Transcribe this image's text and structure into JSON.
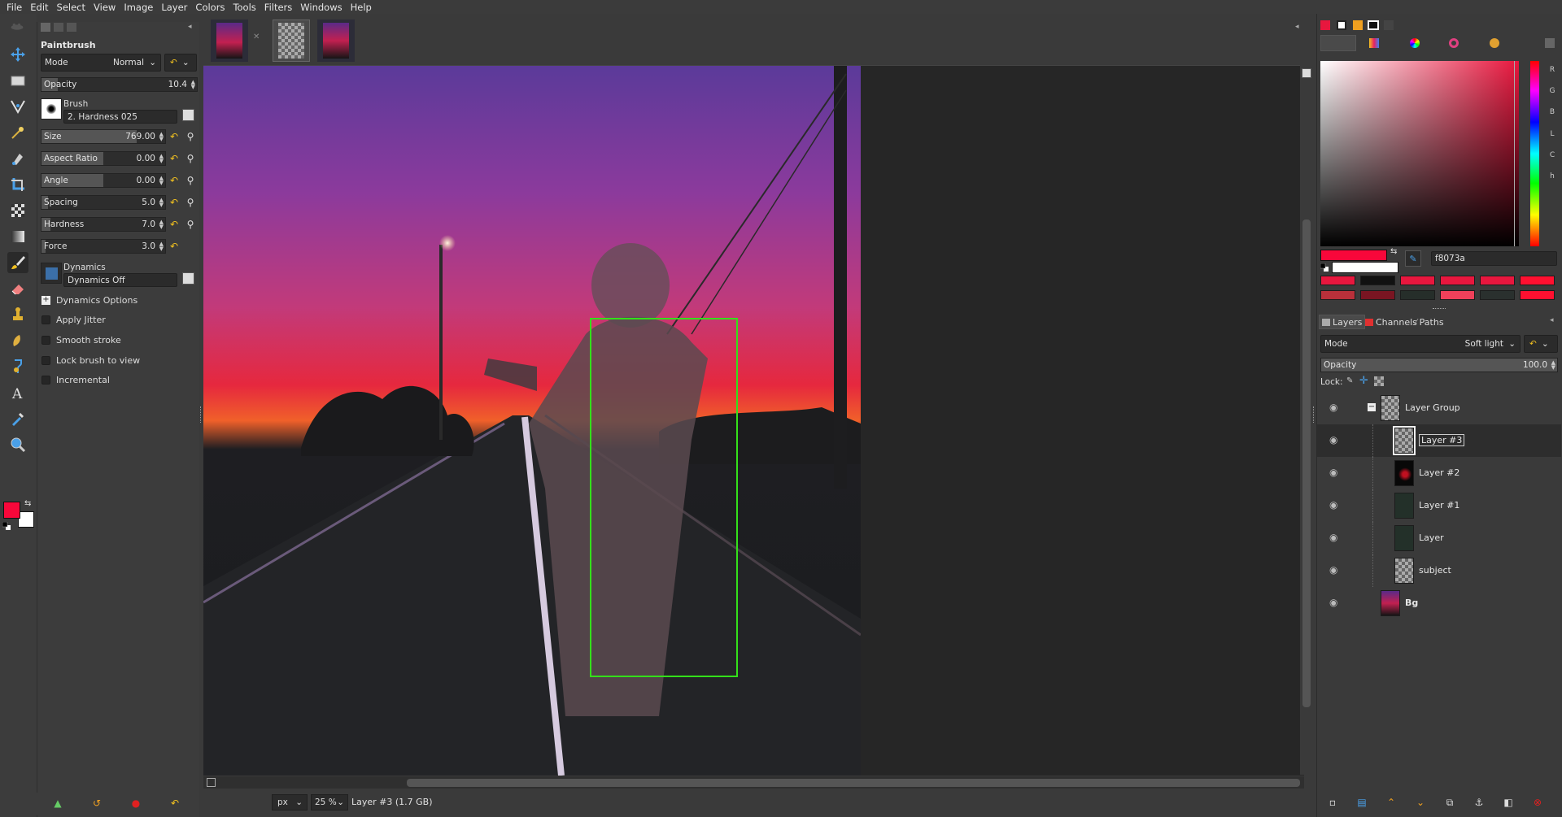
{
  "menubar": {
    "items": [
      "File",
      "Edit",
      "Select",
      "View",
      "Image",
      "Layer",
      "Colors",
      "Tools",
      "Filters",
      "Windows",
      "Help"
    ]
  },
  "tool_options": {
    "title": "Paintbrush",
    "mode_label": "Mode",
    "mode_value": "Normal",
    "opacity": {
      "label": "Opacity",
      "value": "10.4",
      "fraction": 0.104
    },
    "brush_label": "Brush",
    "brush_value": "2. Hardness 025",
    "size": {
      "label": "Size",
      "value": "769.00",
      "fraction": 0.77
    },
    "aspect_ratio": {
      "label": "Aspect Ratio",
      "value": "0.00",
      "fraction": 0.5
    },
    "angle": {
      "label": "Angle",
      "value": "0.00",
      "fraction": 0.5
    },
    "spacing": {
      "label": "Spacing",
      "value": "5.0",
      "fraction": 0.05
    },
    "hardness": {
      "label": "Hardness",
      "value": "7.0",
      "fraction": 0.07
    },
    "force": {
      "label": "Force",
      "value": "3.0",
      "fraction": 0.03
    },
    "dynamics_label": "Dynamics",
    "dynamics_value": "Dynamics Off",
    "dynamics_options": "Dynamics Options",
    "apply_jitter": "Apply Jitter",
    "smooth_stroke": "Smooth stroke",
    "lock_brush": "Lock brush to view",
    "incremental": "Incremental"
  },
  "colors": {
    "foreground": "#f8073a",
    "background": "#ffffff",
    "hex_value": "f8073a",
    "channels": [
      "R",
      "G",
      "B",
      "L",
      "C",
      "h"
    ],
    "history_swatches": [
      "#e8173e",
      "#111111",
      "#e8173e",
      "#e8173e",
      "#e8173e",
      "#ff1030",
      "#b8303a",
      "#7a1522",
      "#262e2a",
      "#f0405a",
      "#2a302e",
      "#ff1030"
    ]
  },
  "layers_panel": {
    "tabs": [
      "Layers",
      "Channels",
      "Paths"
    ],
    "mode_label": "Mode",
    "mode_value": "Soft light",
    "opacity_label": "Opacity",
    "opacity_value": "100.0",
    "lock_label": "Lock:",
    "layers": [
      {
        "name": "Layer Group",
        "kind": "group"
      },
      {
        "name": "Layer #3",
        "kind": "checker",
        "selected": true
      },
      {
        "name": "Layer #2",
        "kind": "dark-red"
      },
      {
        "name": "Layer #1",
        "kind": "dark"
      },
      {
        "name": "Layer",
        "kind": "dark"
      },
      {
        "name": "subject",
        "kind": "checker"
      },
      {
        "name": "Bg",
        "kind": "photo"
      }
    ]
  },
  "statusbar": {
    "unit": "px",
    "zoom": "25 %",
    "text": "Layer #3 (1.7 GB)"
  }
}
